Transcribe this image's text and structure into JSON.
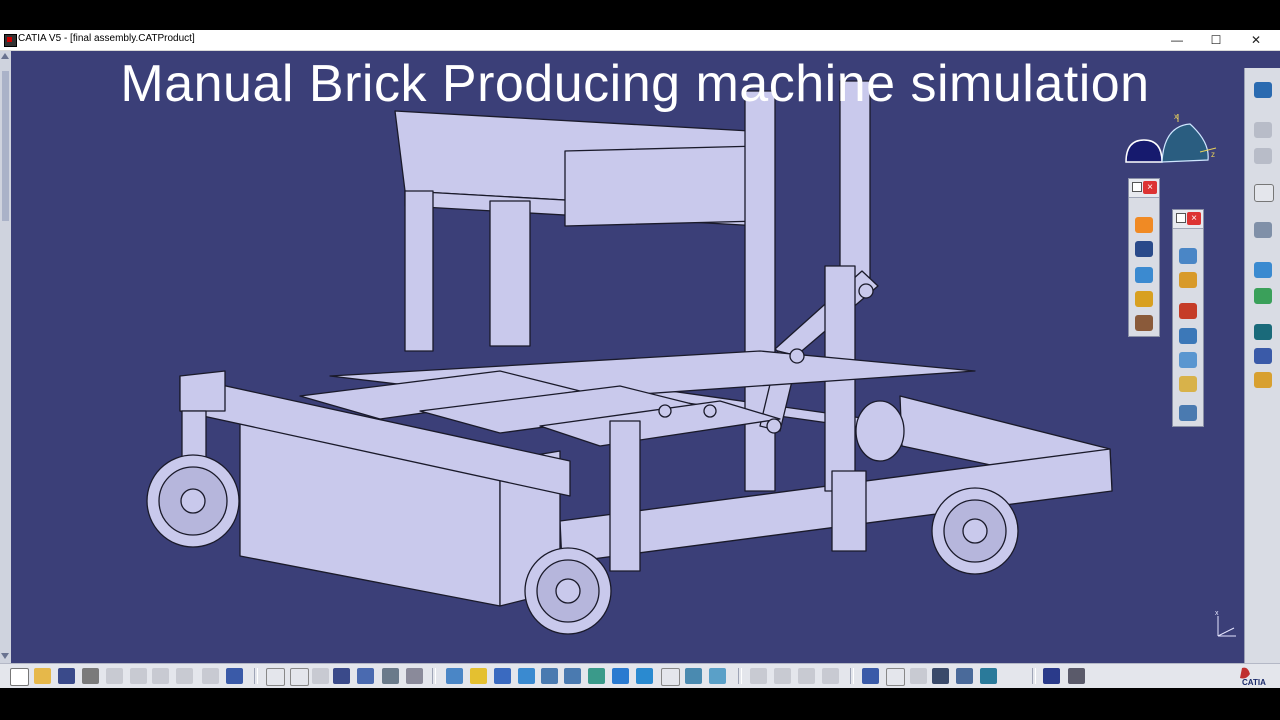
{
  "window": {
    "title": "CATIA V5 - [final assembly.CATProduct]",
    "minimize": "—",
    "maximize": "☐",
    "close": "✕"
  },
  "overlay": {
    "caption": "Manual Brick Producing machine simulation"
  },
  "compass": {
    "x_label": "x",
    "z_label": "z"
  },
  "axis_widget": {
    "x_label": "x"
  },
  "palettes": {
    "left": {
      "close": "×"
    },
    "right": {
      "close": "×"
    }
  },
  "logo": {
    "text": "CATIA"
  },
  "colors": {
    "background": "#3b3f78",
    "model_fill": "#c9c9ec",
    "model_edge": "#1a1a2a",
    "palette_bg": "#d9dce4"
  },
  "icons": {
    "left_palette": [
      "simulation-icon",
      "player-icon",
      "mechanism-icon",
      "joint-icon",
      "tools-icon"
    ],
    "right_palette": [
      "revolute-joint-icon",
      "prismatic-joint-icon",
      "cylindrical-joint-icon",
      "rigid-joint-icon",
      "planar-joint-icon",
      "gear-joint-icon",
      "fix-part-icon"
    ],
    "right_strip": [
      "product-icon",
      "select-icon",
      "explode-icon",
      "constraint-icon",
      "snap-icon",
      "manipulate-icon",
      "clash-icon",
      "measure-icon"
    ],
    "bottom_toolbar": [
      "new-icon",
      "open-icon",
      "save-icon",
      "print-icon",
      "cut-icon",
      "copy-icon",
      "paste-icon",
      "undo-icon",
      "redo-icon",
      "help-icon",
      "formula-icon",
      "comment-icon",
      "table-icon",
      "tree-icon",
      "catalog-icon",
      "options-icon",
      "fly-icon",
      "fit-all-icon",
      "pan-icon",
      "rotate-icon",
      "zoom-in-icon",
      "zoom-out-icon",
      "normal-view-icon",
      "multi-view-icon",
      "iso-view-icon",
      "hide-show-icon",
      "swap-icon",
      "render-icon",
      "link-icon",
      "update-icon",
      "sensor-icon",
      "compass-icon",
      "k-icon",
      "search-icon",
      "ref-icon",
      "scene-icon",
      "light-icon",
      "arrow-icon",
      "spaces-icon"
    ]
  }
}
